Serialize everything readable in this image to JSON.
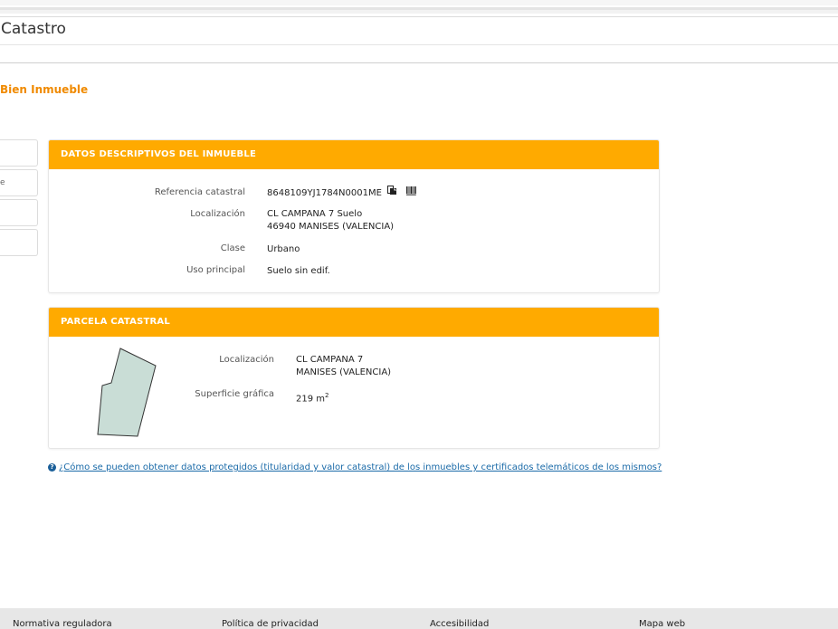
{
  "header": {
    "title": "Catastro"
  },
  "page": {
    "heading": "Bien Inmueble"
  },
  "side_tabs": [
    "",
    "e",
    "",
    ""
  ],
  "descriptive": {
    "title": "DATOS DESCRIPTIVOS DEL INMUEBLE",
    "fields": [
      {
        "label": "Referencia catastral",
        "value": "8648109YJ1784N0001ME"
      },
      {
        "label": "Localización",
        "value": "CL CAMPANA 7 Suelo",
        "value2": "46940 MANISES (VALENCIA)"
      },
      {
        "label": "Clase",
        "value": "Urbano"
      },
      {
        "label": "Uso principal",
        "value": "Suelo sin edif."
      }
    ],
    "icons": [
      "copy-icon",
      "barcode-icon"
    ]
  },
  "parcel": {
    "title": "PARCELA CATASTRAL",
    "location_label": "Localización",
    "location_line1": "CL CAMPANA 7",
    "location_line2": "MANISES (VALENCIA)",
    "surface_label": "Superficie gráfica",
    "surface_value": "219 m",
    "surface_unit_exp": "2",
    "shape_fill": "#c9ddd6"
  },
  "info": {
    "icon": "question-icon",
    "link_text": "¿Cómo se pueden obtener datos protegidos (titularidad y valor catastral) de los inmuebles y certificados telemáticos de los mismos?"
  },
  "footer": {
    "links": [
      "Normativa reguladora",
      "Política de privacidad",
      "Accesibilidad",
      "Mapa web"
    ]
  },
  "colors": {
    "accent": "#ffaa00",
    "heading": "#f08a00",
    "link": "#1a6aa8"
  }
}
